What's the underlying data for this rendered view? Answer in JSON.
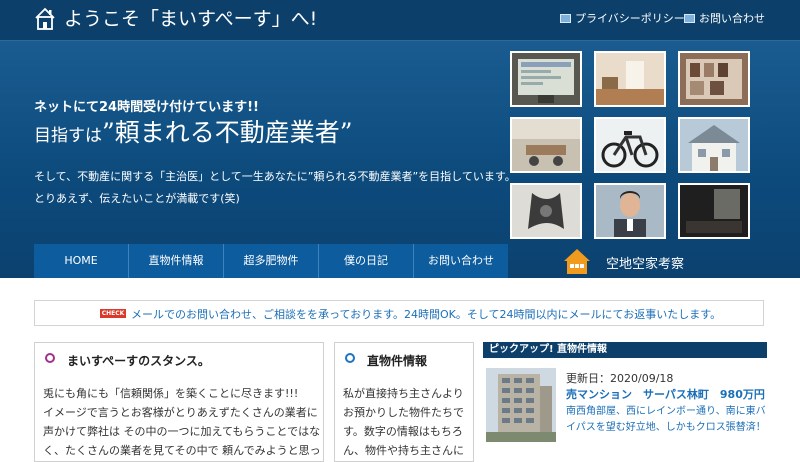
{
  "header": {
    "site_title": "ようこそ「まいすぺーす」へ!",
    "links": [
      "プライバシーポリシー",
      "お問い合わせ"
    ]
  },
  "hero": {
    "tagline": "ネットにて24時間受け付けています!!",
    "headline_prefix": "目指すは",
    "headline_main": "”頼まれる不動産業者”",
    "description_1": "そして、不動産に関する「主治医」として一生あなたに”頼られる不動産業者”を目指しています。",
    "description_2": "とりあえず、伝えたいことが満載です(笑)"
  },
  "nav": {
    "items": [
      "HOME",
      "直物件情報",
      "超多肥物件",
      "僕の日記",
      "お問い合わせ"
    ]
  },
  "akiya": {
    "label": "空地空家考察"
  },
  "notice": {
    "badge": "CHECK",
    "text": "メールでのお問い合わせ、ご相談をを承っております。24時間OK。そして24時間以内にメールにてお返事いたします。"
  },
  "stance": {
    "title": "まいすぺーすのスタンス。",
    "lines": [
      "兎にも角にも「信頼関係」を築くことに尽きます!!!",
      "イメージで言うとお客様がとりあえずたくさんの業者に",
      "声かけて弊社は その中の一つに加えてもらうことではな",
      "く、たくさんの業者を見てその中で 頼んでみようと思っ"
    ]
  },
  "listings": {
    "title": "直物件情報",
    "lines": [
      "私が直接持ち主さんより",
      "お預かりした物件たちで",
      "す。数字の情報はもちろ",
      "ん、物件や持ち主さんに"
    ]
  },
  "pickup": {
    "heading": "ピックアップ! 直物件情報",
    "date": "更新日：2020/09/18",
    "name": "売マンション　サーパス林町　980万円",
    "desc_1": "南西角部屋、西にレインボー通り、南に東バ",
    "desc_2": "イパスを望む好立地、しかもクロス張替済！"
  },
  "colors": {
    "header_bg": "#0c3f6a",
    "hero_bg": "#0d4b7d",
    "nav_bg": "#0d5c9e",
    "link_blue": "#1b6fb8",
    "stance_bullet": "#a3308a",
    "listing_bullet": "#1e73c2",
    "check_red": "#d93a2b",
    "akiya_orange": "#f09a1e"
  }
}
